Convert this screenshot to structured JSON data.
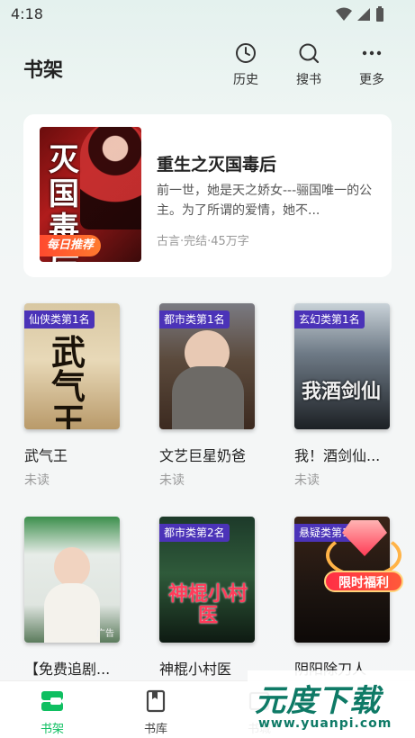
{
  "status_bar": {
    "time": "4:18"
  },
  "header": {
    "title": "书架",
    "actions": [
      {
        "label": "历史",
        "icon": "clock-icon"
      },
      {
        "label": "搜书",
        "icon": "search-icon"
      },
      {
        "label": "更多",
        "icon": "more-icon"
      }
    ]
  },
  "featured": {
    "badge": "每日推荐",
    "title": "重生之灭国毒后",
    "description": "前一世，她是天之娇女---骊国唯一的公主。为了所谓的爱情，她不...",
    "meta": "古言·完结·45万字",
    "cover_text": "灭国毒后"
  },
  "books": [
    {
      "rank": "仙侠类第1名",
      "title": "武气王",
      "status": "未读",
      "cover_text": "武气王"
    },
    {
      "rank": "都市类第1名",
      "title": "文艺巨星奶爸",
      "status": "未读",
      "cover_text": ""
    },
    {
      "rank": "玄幻类第1名",
      "title": "我！酒剑仙...",
      "status": "未读",
      "cover_text": "我酒剑仙"
    },
    {
      "rank": "",
      "title": "【免费追剧...",
      "status": "",
      "cover_text": "广告"
    },
    {
      "rank": "都市类第2名",
      "title": "神棍小村医",
      "status": "",
      "cover_text": "神棍小村医"
    },
    {
      "rank": "悬疑类第1名",
      "title": "阴阳除刀人",
      "status": "",
      "cover_text": ""
    }
  ],
  "promo": {
    "label": "限时福利"
  },
  "bottom_nav": [
    {
      "label": "书架",
      "active": true
    },
    {
      "label": "书库",
      "active": false
    },
    {
      "label": "书城",
      "active": false
    }
  ],
  "watermark": {
    "text": "元度下载",
    "url": "www.yuanpi.com"
  },
  "colors": {
    "accent": "#0fbf61",
    "rank_badge": "#4b33b8",
    "daily_badge": "#ff4a2e"
  }
}
